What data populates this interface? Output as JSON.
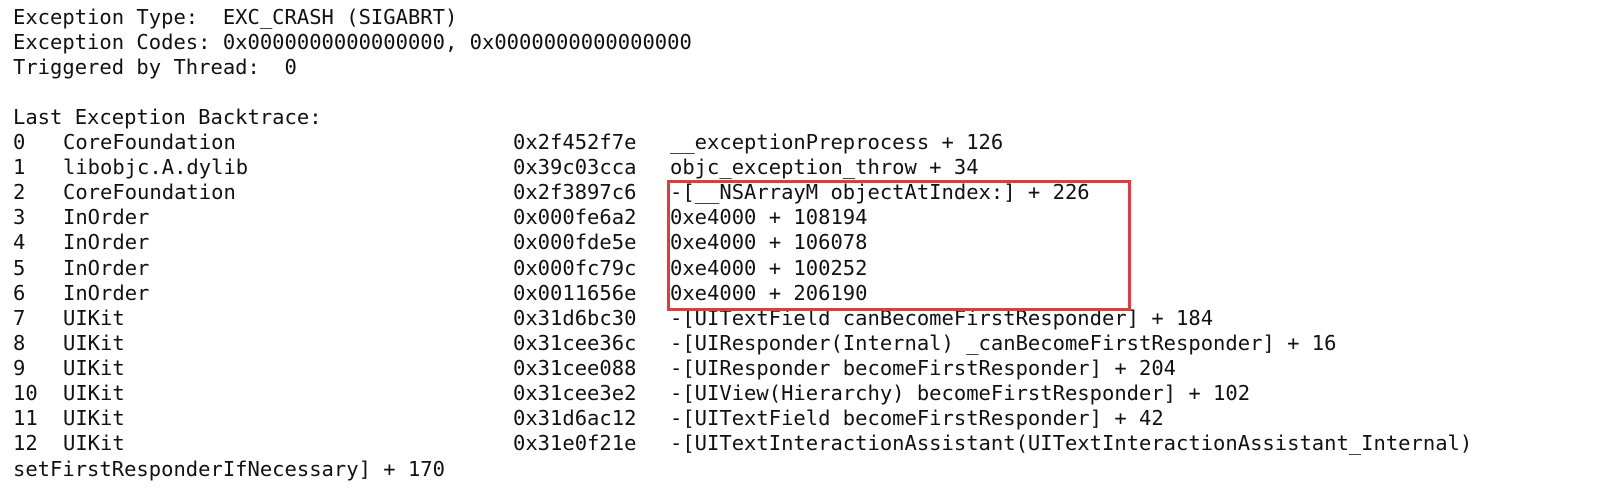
{
  "header": {
    "exception_type": "Exception Type:  EXC_CRASH (SIGABRT)",
    "exception_codes": "Exception Codes: 0x0000000000000000, 0x0000000000000000",
    "triggered_by": "Triggered by Thread:  0"
  },
  "backtrace": {
    "title": "Last Exception Backtrace:",
    "frames": [
      {
        "num": "0",
        "image": "CoreFoundation",
        "address": "0x2f452f7e",
        "symbol": "__exceptionPreprocess + 126"
      },
      {
        "num": "1",
        "image": "libobjc.A.dylib",
        "address": "0x39c03cca",
        "symbol": "objc_exception_throw + 34"
      },
      {
        "num": "2",
        "image": "CoreFoundation",
        "address": "0x2f3897c6",
        "symbol": "-[__NSArrayM objectAtIndex:] + 226"
      },
      {
        "num": "3",
        "image": "InOrder",
        "address": "0x000fe6a2",
        "symbol": "0xe4000 + 108194"
      },
      {
        "num": "4",
        "image": "InOrder",
        "address": "0x000fde5e",
        "symbol": "0xe4000 + 106078"
      },
      {
        "num": "5",
        "image": "InOrder",
        "address": "0x000fc79c",
        "symbol": "0xe4000 + 100252"
      },
      {
        "num": "6",
        "image": "InOrder",
        "address": "0x0011656e",
        "symbol": "0xe4000 + 206190"
      },
      {
        "num": "7",
        "image": "UIKit",
        "address": "0x31d6bc30",
        "symbol": "-[UITextField canBecomeFirstResponder] + 184"
      },
      {
        "num": "8",
        "image": "UIKit",
        "address": "0x31cee36c",
        "symbol": "-[UIResponder(Internal) _canBecomeFirstResponder] + 16"
      },
      {
        "num": "9",
        "image": "UIKit",
        "address": "0x31cee088",
        "symbol": "-[UIResponder becomeFirstResponder] + 204"
      },
      {
        "num": "10",
        "image": "UIKit",
        "address": "0x31cee3e2",
        "symbol": "-[UIView(Hierarchy) becomeFirstResponder] + 102"
      },
      {
        "num": "11",
        "image": "UIKit",
        "address": "0x31d6ac12",
        "symbol": "-[UITextField becomeFirstResponder] + 42"
      },
      {
        "num": "12",
        "image": "UIKit",
        "address": "0x31e0f21e",
        "symbol": "-[UITextInteractionAssistant(UITextInteractionAssistant_Internal)"
      }
    ],
    "continuation": "setFirstResponderIfNecessary] + 170"
  },
  "highlight_color": "#e23b3b"
}
